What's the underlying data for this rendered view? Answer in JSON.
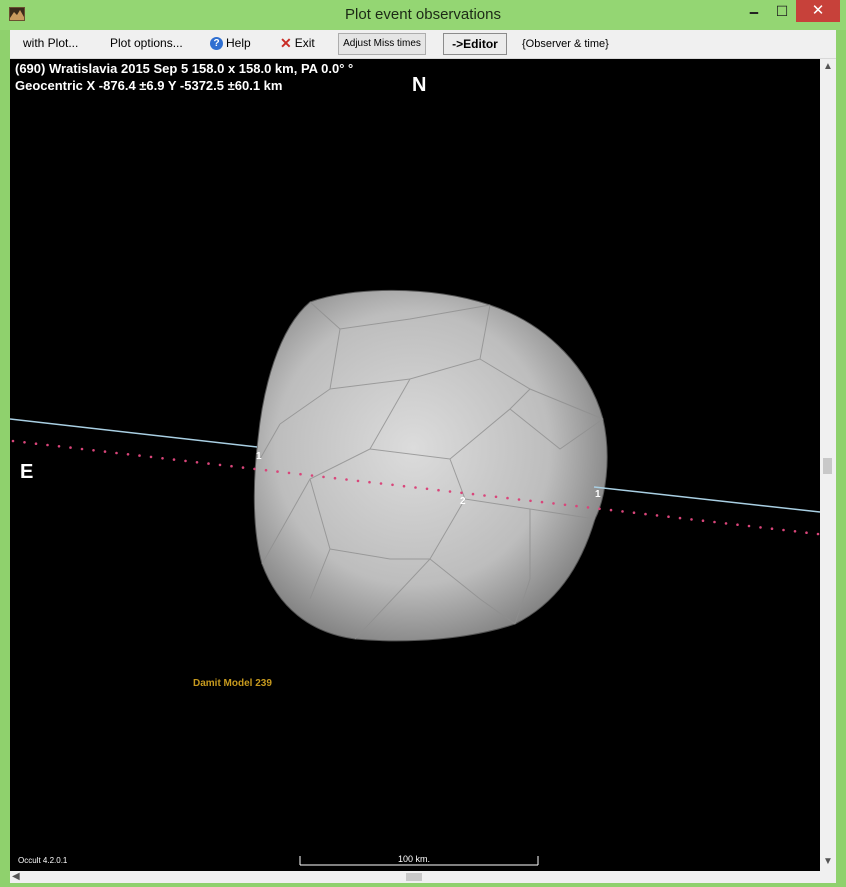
{
  "window": {
    "title": "Plot event observations",
    "minimize": "🗕",
    "maximize": "☐",
    "close": "✕"
  },
  "menu": {
    "with_plot": "with Plot...",
    "plot_options": "Plot options...",
    "help": "Help",
    "exit": "Exit",
    "adjust_miss_times": "Adjust Miss times",
    "editor": "->Editor",
    "observer_time": "{Observer & time}"
  },
  "plot": {
    "header_line1": "(690) Wratislavia  2015 Sep 5  158.0 x 158.0 km, PA 0.0° °",
    "header_line2": "Geocentric  X  -876.4 ±6.9  Y  -5372.5 ±60.1 km",
    "north_label": "N",
    "east_label": "E",
    "model_label": "Damit Model 239",
    "version_label": "Occult 4.2.0.1",
    "scale_label": "100 km.",
    "chord_labels": [
      "1",
      "2",
      "1"
    ],
    "colors": {
      "background": "#000000",
      "chord_line": "#a9cfe3",
      "path_dots": "#d9457a",
      "model_label": "#c79a1e"
    }
  }
}
